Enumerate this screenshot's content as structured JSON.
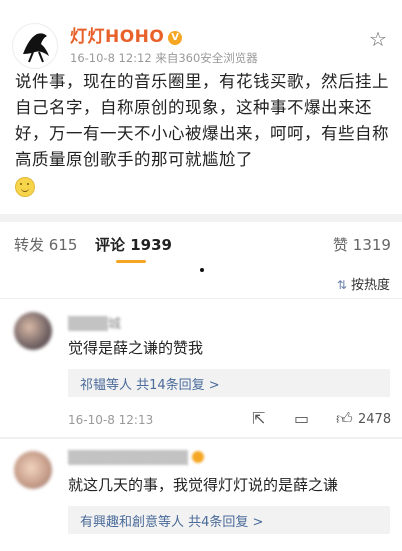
{
  "post": {
    "username": "灯灯HOHO",
    "meta": "16-10-8 12:12   来自360安全浏览器",
    "content": "说件事，现在的音乐圈里，有花钱买歌，然后挂上自己名字，自称原创的现象，这种事不爆出来还好，万一有一天不小心被爆出来，呵呵，有些自称高质量原创歌手的那可就尴尬了"
  },
  "tabs": {
    "repost_label": "转发",
    "repost_count": "615",
    "comment_label": "评论",
    "comment_count": "1939",
    "like_label": "赞",
    "like_count": "1319"
  },
  "sort_label": "按热度",
  "comments": [
    {
      "name": "▒▒▒▒城",
      "text": "觉得是薛之谦的赞我",
      "replies": "祁韫等人  共14条回复 >",
      "time": "16-10-8 12:13",
      "likes": "2478"
    },
    {
      "name": "▒▒▒▒▒▒▒▒▒▒▒▒",
      "text": "就这几天的事，我觉得灯灯说的是薛之谦",
      "replies": "有興趣和創意等人  共4条回复 >"
    }
  ],
  "colors": {
    "username": "#e8612a",
    "link": "#4a6b9a",
    "tab_underline": "#f5a623"
  }
}
